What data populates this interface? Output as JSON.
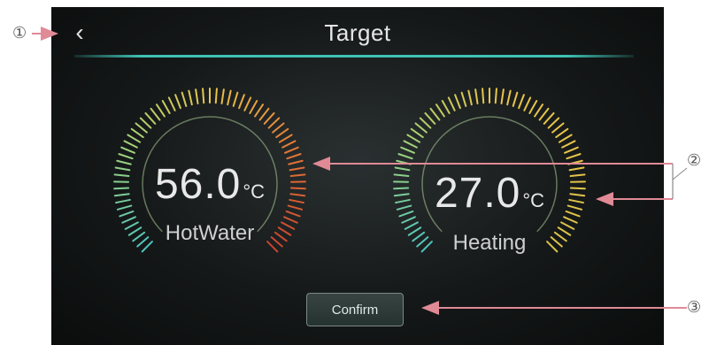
{
  "header": {
    "title": "Target",
    "back_icon": "chevron-left-icon"
  },
  "gauges": [
    {
      "id": "hotwater",
      "value": "56.0",
      "unit": "°C",
      "label": "HotWater",
      "colors": [
        "#4fc4be",
        "#9fd27c",
        "#e8c54a",
        "#e47838",
        "#c8442e"
      ]
    },
    {
      "id": "heating",
      "value": "27.0",
      "unit": "°C",
      "label": "Heating",
      "colors": [
        "#4fc4be",
        "#9fd27c",
        "#e8c54a",
        "#e8c54a",
        "#d9c24c"
      ]
    }
  ],
  "confirm_button": {
    "label": "Confirm"
  },
  "callouts": {
    "c1": "①",
    "c2": "②",
    "c3": "③"
  },
  "colors": {
    "accent": "#3ec3b6",
    "callout_arrow": "#e08a96",
    "text": "#e6e6e6"
  }
}
